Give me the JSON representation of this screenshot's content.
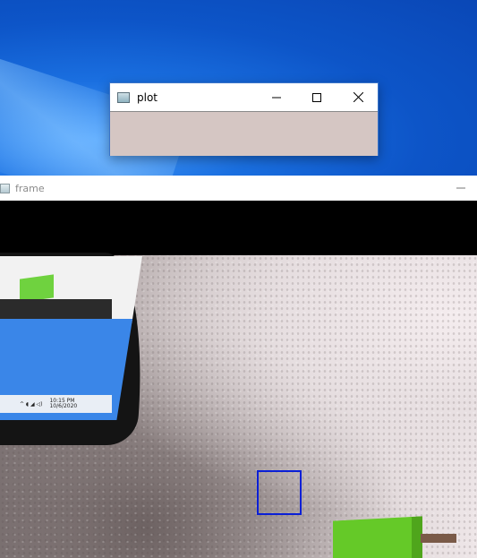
{
  "plot_window": {
    "title": "plot",
    "controls": {
      "minimize": "minimize",
      "maximize": "maximize",
      "close": "close"
    },
    "body_color": "#d5c6c3"
  },
  "frame_window": {
    "title": "frame",
    "controls": {
      "minimize": "minimize"
    }
  },
  "video": {
    "monitor_clock_time": "10:15 PM",
    "monitor_clock_date": "10/6/2020",
    "target_box_color": "#0a1fd6"
  },
  "colors": {
    "desktop_blue": "#1466d6",
    "green_object": "#65c928"
  }
}
